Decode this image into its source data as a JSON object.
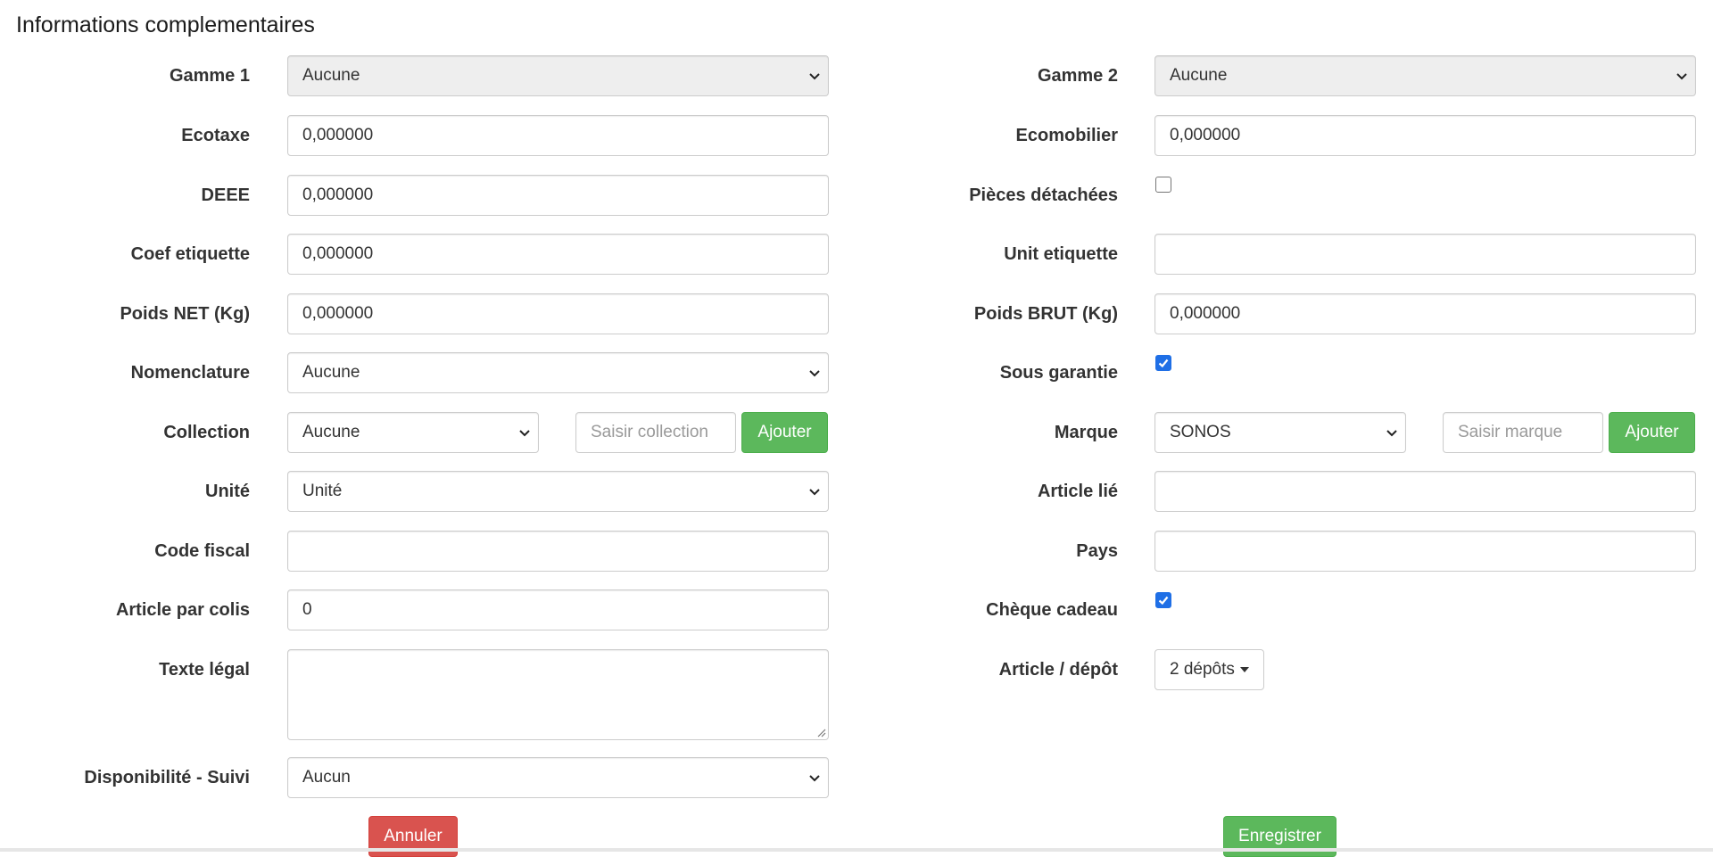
{
  "section_title": "Informations complementaires",
  "left": {
    "gamme1": {
      "label": "Gamme 1",
      "value": "Aucune"
    },
    "ecotaxe": {
      "label": "Ecotaxe",
      "value": "0,000000"
    },
    "deee": {
      "label": "DEEE",
      "value": "0,000000"
    },
    "coef_etiquette": {
      "label": "Coef etiquette",
      "value": "0,000000"
    },
    "poids_net": {
      "label": "Poids NET (Kg)",
      "value": "0,000000"
    },
    "nomenclature": {
      "label": "Nomenclature",
      "value": "Aucune"
    },
    "collection": {
      "label": "Collection",
      "value": "Aucune",
      "input_placeholder": "Saisir collection",
      "add_label": "Ajouter"
    },
    "unite": {
      "label": "Unité",
      "value": "Unité"
    },
    "code_fiscal": {
      "label": "Code fiscal",
      "value": ""
    },
    "article_par_colis": {
      "label": "Article par colis",
      "value": "0"
    },
    "texte_legal": {
      "label": "Texte légal",
      "value": ""
    },
    "disponibilite": {
      "label": "Disponibilité - Suivi",
      "value": "Aucun"
    }
  },
  "right": {
    "gamme2": {
      "label": "Gamme 2",
      "value": "Aucune"
    },
    "ecomobilier": {
      "label": "Ecomobilier",
      "value": "0,000000"
    },
    "pieces_detachees": {
      "label": "Pièces détachées",
      "checked": false
    },
    "unit_etiquette": {
      "label": "Unit etiquette",
      "value": ""
    },
    "poids_brut": {
      "label": "Poids BRUT (Kg)",
      "value": "0,000000"
    },
    "sous_garantie": {
      "label": "Sous garantie",
      "checked": true
    },
    "marque": {
      "label": "Marque",
      "value": "SONOS",
      "input_placeholder": "Saisir marque",
      "add_label": "Ajouter"
    },
    "article_lie": {
      "label": "Article lié",
      "value": ""
    },
    "pays": {
      "label": "Pays",
      "value": ""
    },
    "cheque_cadeau": {
      "label": "Chèque cadeau",
      "checked": true
    },
    "article_depot": {
      "label": "Article / dépôt",
      "button_label": "2 dépôts"
    }
  },
  "actions": {
    "cancel_label": "Annuler",
    "save_label": "Enregistrer"
  },
  "colors": {
    "green": "#5cb85c",
    "red": "#d9534f",
    "checkbox_blue": "#1f6fe6"
  }
}
